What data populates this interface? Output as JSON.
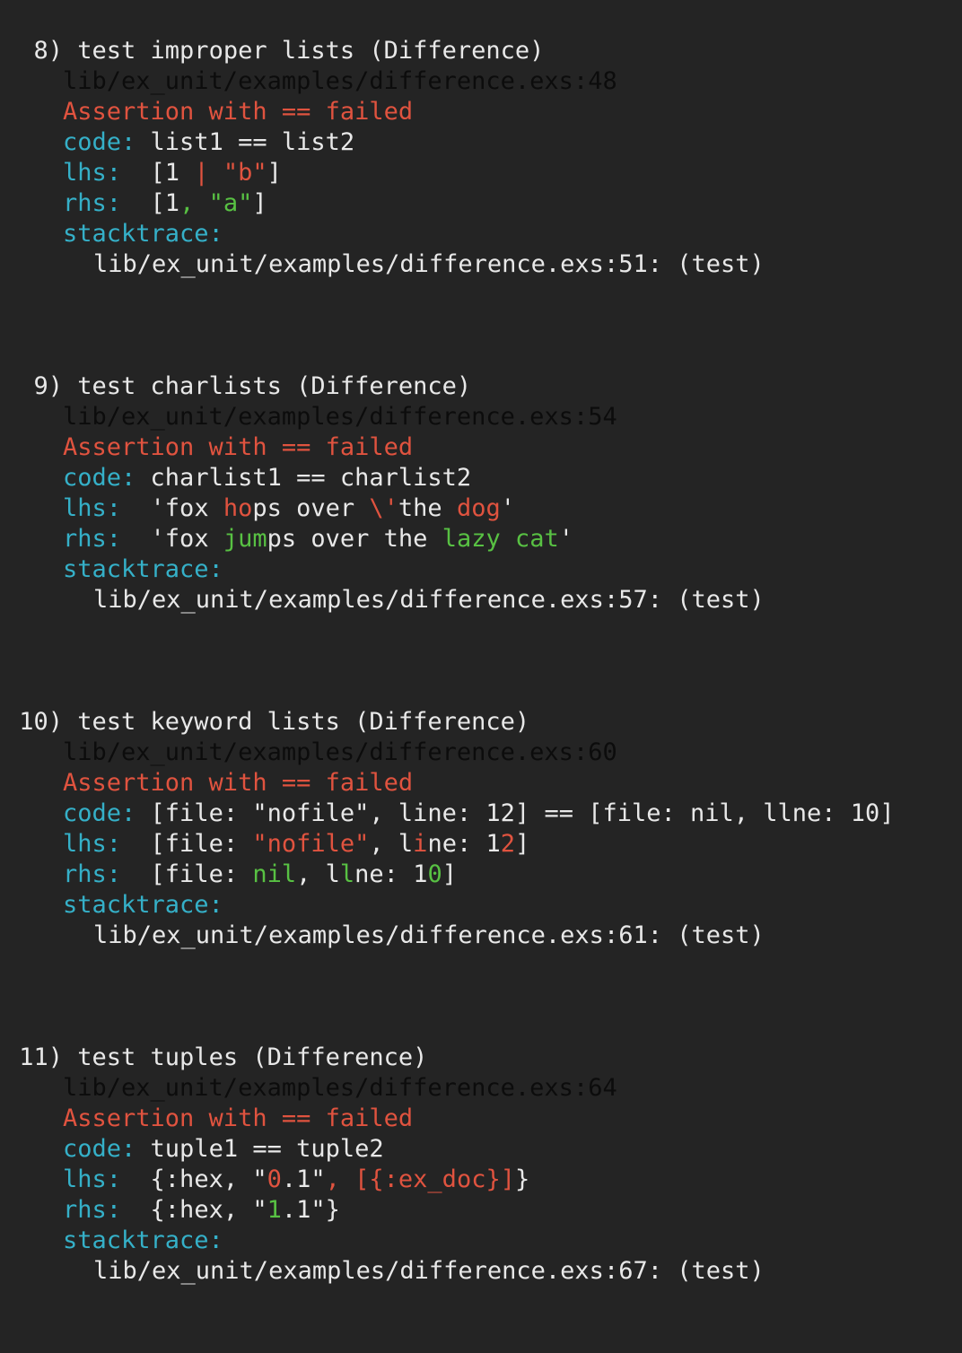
{
  "failures": [
    {
      "number": "8)",
      "title": "test improper lists (Difference)",
      "location": "lib/ex_unit/examples/difference.exs:48",
      "assertion": "Assertion with == failed",
      "code_label": "code:",
      "code": "list1 == list2",
      "lhs_label": "lhs:",
      "lhs": [
        {
          "t": "[1 ",
          "c": "plain"
        },
        {
          "t": "|",
          "c": "del"
        },
        {
          "t": " ",
          "c": "plain"
        },
        {
          "t": "\"b\"",
          "c": "del"
        },
        {
          "t": "]",
          "c": "plain"
        }
      ],
      "rhs_label": "rhs:",
      "rhs": [
        {
          "t": "[1",
          "c": "plain"
        },
        {
          "t": ",",
          "c": "add"
        },
        {
          "t": " ",
          "c": "plain"
        },
        {
          "t": "\"a\"",
          "c": "add"
        },
        {
          "t": "]",
          "c": "plain"
        }
      ],
      "stacktrace_label": "stacktrace:",
      "stacktrace": "lib/ex_unit/examples/difference.exs:51: (test)"
    },
    {
      "number": "9)",
      "title": "test charlists (Difference)",
      "location": "lib/ex_unit/examples/difference.exs:54",
      "assertion": "Assertion with == failed",
      "code_label": "code:",
      "code": "charlist1 == charlist2",
      "lhs_label": "lhs:",
      "lhs": [
        {
          "t": "'fox ",
          "c": "plain"
        },
        {
          "t": "ho",
          "c": "del"
        },
        {
          "t": "ps over ",
          "c": "plain"
        },
        {
          "t": "\\'",
          "c": "del"
        },
        {
          "t": "the ",
          "c": "plain"
        },
        {
          "t": "dog",
          "c": "del"
        },
        {
          "t": "'",
          "c": "plain"
        }
      ],
      "rhs_label": "rhs:",
      "rhs": [
        {
          "t": "'fox ",
          "c": "plain"
        },
        {
          "t": "jum",
          "c": "add"
        },
        {
          "t": "ps over the ",
          "c": "plain"
        },
        {
          "t": "lazy cat",
          "c": "add"
        },
        {
          "t": "'",
          "c": "plain"
        }
      ],
      "stacktrace_label": "stacktrace:",
      "stacktrace": "lib/ex_unit/examples/difference.exs:57: (test)"
    },
    {
      "number": "10)",
      "title": "test keyword lists (Difference)",
      "location": "lib/ex_unit/examples/difference.exs:60",
      "assertion": "Assertion with == failed",
      "code_label": "code:",
      "code": "[file: \"nofile\", line: 12] == [file: nil, llne: 10]",
      "lhs_label": "lhs:",
      "lhs": [
        {
          "t": "[file: ",
          "c": "plain"
        },
        {
          "t": "\"nofile\"",
          "c": "del"
        },
        {
          "t": ", l",
          "c": "plain"
        },
        {
          "t": "i",
          "c": "del"
        },
        {
          "t": "ne: 1",
          "c": "plain"
        },
        {
          "t": "2",
          "c": "del"
        },
        {
          "t": "]",
          "c": "plain"
        }
      ],
      "rhs_label": "rhs:",
      "rhs": [
        {
          "t": "[file: ",
          "c": "plain"
        },
        {
          "t": "nil",
          "c": "add"
        },
        {
          "t": ", l",
          "c": "plain"
        },
        {
          "t": "l",
          "c": "add"
        },
        {
          "t": "ne: 1",
          "c": "plain"
        },
        {
          "t": "0",
          "c": "add"
        },
        {
          "t": "]",
          "c": "plain"
        }
      ],
      "stacktrace_label": "stacktrace:",
      "stacktrace": "lib/ex_unit/examples/difference.exs:61: (test)"
    },
    {
      "number": "11)",
      "title": "test tuples (Difference)",
      "location": "lib/ex_unit/examples/difference.exs:64",
      "assertion": "Assertion with == failed",
      "code_label": "code:",
      "code": "tuple1 == tuple2",
      "lhs_label": "lhs:",
      "lhs": [
        {
          "t": "{:hex, \"",
          "c": "plain"
        },
        {
          "t": "0",
          "c": "del"
        },
        {
          "t": ".1\"",
          "c": "plain"
        },
        {
          "t": ", [{:ex_doc}]",
          "c": "del"
        },
        {
          "t": "}",
          "c": "plain"
        }
      ],
      "rhs_label": "rhs:",
      "rhs": [
        {
          "t": "{:hex, \"",
          "c": "plain"
        },
        {
          "t": "1",
          "c": "add"
        },
        {
          "t": ".1\"}",
          "c": "plain"
        }
      ],
      "stacktrace_label": "stacktrace:",
      "stacktrace": "lib/ex_unit/examples/difference.exs:67: (test)"
    }
  ],
  "colors": {
    "background": "#242424",
    "text": "#e8e8e8",
    "path": "#0c0c0c",
    "error": "#e0533f",
    "key": "#35b0c8",
    "added": "#58c143",
    "deleted": "#e0533f"
  }
}
